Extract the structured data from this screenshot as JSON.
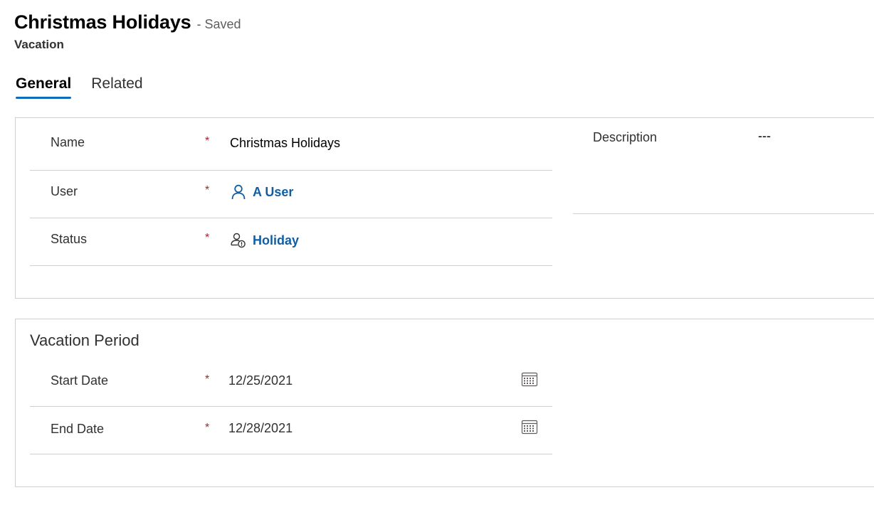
{
  "record": {
    "title": "Christmas Holidays",
    "saved_status": "- Saved",
    "entity_name": "Vacation"
  },
  "tabs": [
    {
      "label": "General",
      "active": true
    },
    {
      "label": "Related",
      "active": false
    }
  ],
  "general": {
    "required_mark": "*",
    "fields": {
      "name": {
        "label": "Name",
        "value": "Christmas Holidays"
      },
      "user": {
        "label": "User",
        "value": "A User",
        "icon": "person-icon"
      },
      "status": {
        "label": "Status",
        "value": "Holiday",
        "icon": "person-status-icon"
      }
    },
    "description": {
      "label": "Description",
      "value": "---"
    }
  },
  "vacation_period": {
    "title": "Vacation Period",
    "fields": {
      "start_date": {
        "label": "Start Date",
        "value": "12/25/2021",
        "icon": "calendar-icon"
      },
      "end_date": {
        "label": "End Date",
        "value": "12/28/2021",
        "icon": "calendar-icon"
      }
    }
  },
  "colors": {
    "accent": "#0f6cbd",
    "link": "#115ea3",
    "required": "#a4262c",
    "border": "#d2d0ce"
  }
}
